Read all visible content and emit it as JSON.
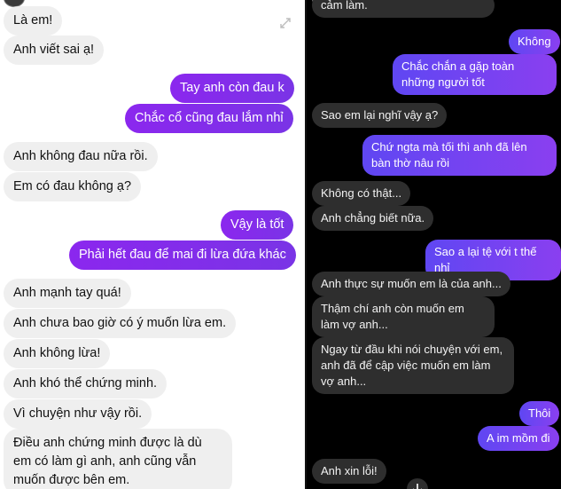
{
  "left": {
    "messages": [
      {
        "text": "Là em!",
        "dir": "in"
      },
      {
        "text": "Anh viết sai ạ!",
        "dir": "in"
      },
      {
        "text": "Tay anh còn đau k",
        "dir": "out"
      },
      {
        "text": "Chắc cổ cũng đau lắm nhỉ",
        "dir": "out"
      },
      {
        "text": "Anh không đau nữa rồi.",
        "dir": "in"
      },
      {
        "text": "Em có đau không ạ?",
        "dir": "in"
      },
      {
        "text": "Vậy là tốt",
        "dir": "out"
      },
      {
        "text": "Phải hết đau để mai đi lừa đứa khác",
        "dir": "out"
      },
      {
        "text": "Anh mạnh tay quá!",
        "dir": "in"
      },
      {
        "text": "Anh chưa bao giờ có ý muốn lừa em.",
        "dir": "in"
      },
      {
        "text": "Anh không lừa!",
        "dir": "in"
      },
      {
        "text": "Anh khó thể chứng minh.",
        "dir": "in"
      },
      {
        "text": "Vì chuyện như vậy rồi.",
        "dir": "in"
      },
      {
        "text": "Điều anh chứng minh được là dù em có làm gì anh, anh cũng vẫn muốn được bên em.",
        "dir": "in"
      }
    ]
  },
  "right": {
    "messages": [
      {
        "text": "cảm làm.",
        "dir": "in"
      },
      {
        "text": "Không",
        "dir": "out"
      },
      {
        "text": "Chắc chắn a gặp toàn những người tốt",
        "dir": "out"
      },
      {
        "text": "Sao em lại nghĩ vậy ạ?",
        "dir": "in"
      },
      {
        "text": "Chứ ngta mà tối thì anh đã lên bàn thờ nâu rồi",
        "dir": "out"
      },
      {
        "text": "Không có thật...",
        "dir": "in"
      },
      {
        "text": "Anh chẳng biết nữa.",
        "dir": "in"
      },
      {
        "text": "Sao a lại tệ với t thế nhỉ",
        "dir": "out"
      },
      {
        "text": "Anh thực sự muốn em là của anh...",
        "dir": "in"
      },
      {
        "text": "Thậm chí anh còn muốn em làm vợ anh...",
        "dir": "in"
      },
      {
        "text": "Ngay từ đầu khi nói chuyện với em, anh đã để cập việc muốn em làm vợ anh...",
        "dir": "in"
      },
      {
        "text": "Thôi",
        "dir": "out"
      },
      {
        "text": "A im mồm đi",
        "dir": "out"
      },
      {
        "text": "Anh xin lỗi!",
        "dir": "in"
      }
    ]
  }
}
